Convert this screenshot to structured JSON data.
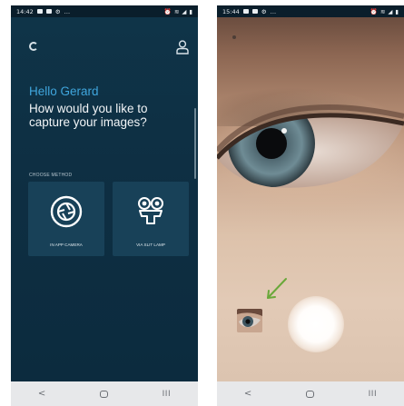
{
  "left_phone": {
    "status": {
      "time": "14:42"
    },
    "greeting": "Hello Gerard",
    "headline": "How would you like to capture your images?",
    "choose_method": "CHOOSE METHOD",
    "methods": [
      {
        "label": "IN APP CAMERA",
        "icon": "camera-aperture-icon"
      },
      {
        "label": "VIA SLIT LAMP",
        "icon": "slit-lamp-icon"
      }
    ],
    "nav": {
      "back": "<",
      "recents": "III"
    }
  },
  "right_phone": {
    "status": {
      "time": "15:44"
    },
    "nav": {
      "back": "<",
      "recents": "III"
    },
    "arrow_color": "#6aa83a"
  },
  "colors": {
    "app_bg": "#0e2f43",
    "card_bg": "#184158",
    "greeting": "#3fa6dd"
  }
}
